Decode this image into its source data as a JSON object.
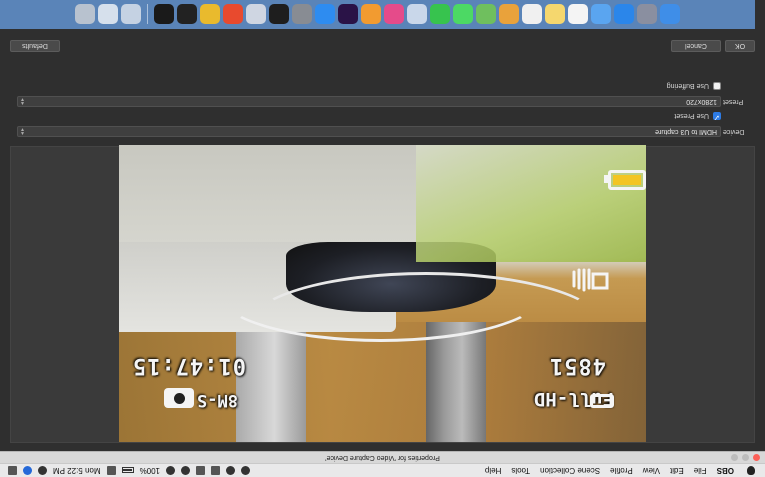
{
  "menubar": {
    "app_name": "OBS",
    "items": [
      "File",
      "Edit",
      "View",
      "Profile",
      "Scene Collection",
      "Tools",
      "Help"
    ],
    "battery": "100%",
    "clock": "Mon 5:22 PM"
  },
  "window": {
    "title": "Properties for 'Video Capture Device'"
  },
  "preview": {
    "counter": "4851",
    "timecode": "01:47:15",
    "format": "Full-HD",
    "quality": "8M-S"
  },
  "form": {
    "device_label": "Device",
    "device_value": "HDMI to U3 capture",
    "use_preset_label": "Use Preset",
    "use_preset_checked": true,
    "preset_label": "Preset",
    "preset_value": "1280x720",
    "use_buffering_label": "Use Buffering",
    "use_buffering_checked": false
  },
  "buttons": {
    "defaults": "Defaults",
    "cancel": "Cancel",
    "ok": "OK"
  },
  "colors": {
    "accent": "#2d7be5",
    "battery_fill": "#f3c523",
    "close_light": "#fc5f57"
  },
  "dock": {
    "icons": [
      {
        "name": "finder-icon",
        "color": "#3f8ee8"
      },
      {
        "name": "launchpad-icon",
        "color": "#8a8fa0"
      },
      {
        "name": "safari-icon",
        "color": "#2b86ea"
      },
      {
        "name": "mail-icon",
        "color": "#5aa5f0"
      },
      {
        "name": "calendar-icon",
        "color": "#f4f4f4"
      },
      {
        "name": "notes-icon",
        "color": "#f5d76e"
      },
      {
        "name": "reminders-icon",
        "color": "#f0f0f0"
      },
      {
        "name": "photos-icon",
        "color": "#e9a23b"
      },
      {
        "name": "maps-icon",
        "color": "#6fbf5e"
      },
      {
        "name": "messages-icon",
        "color": "#4cd964"
      },
      {
        "name": "facetime-icon",
        "color": "#37c34e"
      },
      {
        "name": "preview-icon",
        "color": "#c9d7ea"
      },
      {
        "name": "itunes-icon",
        "color": "#e54b8a"
      },
      {
        "name": "ibooks-icon",
        "color": "#f29b30"
      },
      {
        "name": "premiere-icon",
        "color": "#2a1347"
      },
      {
        "name": "appstore-icon",
        "color": "#2e8cf0"
      },
      {
        "name": "system-preferences-icon",
        "color": "#888c93"
      },
      {
        "name": "terminal-icon",
        "color": "#1e1e1e"
      },
      {
        "name": "usb-icon",
        "color": "#cfd6e2"
      },
      {
        "name": "brush-icon",
        "color": "#e84a2e"
      },
      {
        "name": "chrome-icon",
        "color": "#e9ba2d"
      },
      {
        "name": "terminal2-icon",
        "color": "#222222"
      },
      {
        "name": "obs-icon",
        "color": "#1a1a1a"
      },
      {
        "name": "downloads-icon",
        "color": "#c5d2e3"
      },
      {
        "name": "documents-icon",
        "color": "#d6e0ec"
      },
      {
        "name": "trash-icon",
        "color": "#b8c2cf"
      }
    ]
  }
}
